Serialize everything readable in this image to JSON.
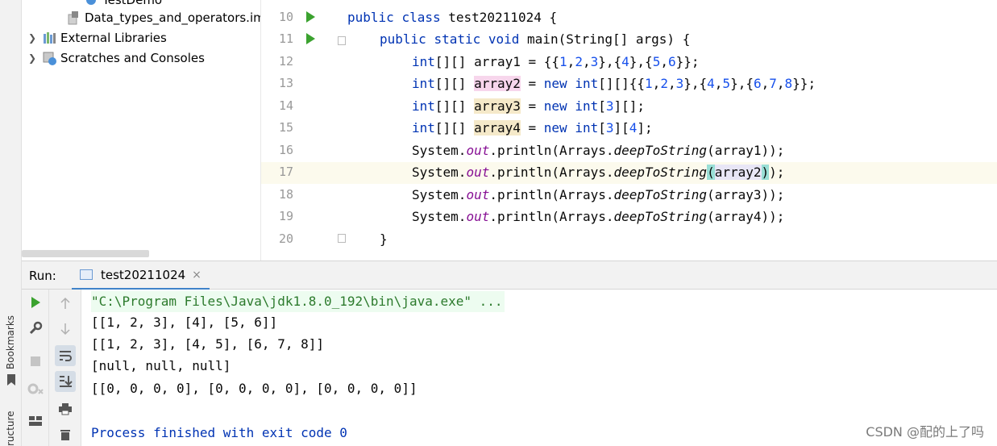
{
  "tool_strip": {
    "bookmarks_label": "Bookmarks",
    "structure_label": "ructure"
  },
  "project_tree": {
    "items": [
      {
        "label": "TestDemo",
        "kind": "module"
      },
      {
        "label": "Data_types_and_operators.iml",
        "kind": "iml-file"
      },
      {
        "label": "External Libraries",
        "kind": "libraries"
      },
      {
        "label": "Scratches and Consoles",
        "kind": "scratches"
      }
    ]
  },
  "editor": {
    "line_numbers": [
      "10",
      "11",
      "12",
      "13",
      "14",
      "15",
      "16",
      "17",
      "18",
      "19",
      "20"
    ],
    "current_line": "17",
    "lines": {
      "l10": {
        "kw1": "public",
        "kw2": "class",
        "rest": " test20211024 {"
      },
      "l11": {
        "kw1": "public",
        "kw2": "static",
        "kw3": "void",
        "rest": " main(String[] args) {"
      },
      "l12": {
        "type": "int",
        "a": "[][] array1 = {{",
        "n1": "1",
        "c1": ",",
        "n2": "2",
        "c2": ",",
        "n3": "3",
        "b1": "},{",
        "n4": "4",
        "b2": "},{",
        "n5": "5",
        "c3": ",",
        "n6": "6",
        "end": "}};"
      },
      "l13": {
        "type": "int",
        "a": "[][] ",
        "var": "array2",
        "b": " = ",
        "kw": "new",
        "sp": " ",
        "type2": "int",
        "c": "[][]{{",
        "n1": "1",
        "c1": ",",
        "n2": "2",
        "c2": ",",
        "n3": "3",
        "d1": "},{",
        "n4": "4",
        "c3": ",",
        "n5": "5",
        "d2": "},{",
        "n6": "6",
        "c4": ",",
        "n7": "7",
        "c5": ",",
        "n8": "8",
        "end": "}};"
      },
      "l14": {
        "type": "int",
        "a": "[][] ",
        "var": "array3",
        "b": " = ",
        "kw": "new",
        "sp": " ",
        "type2": "int",
        "c": "[",
        "n1": "3",
        "end": "][];"
      },
      "l15": {
        "type": "int",
        "a": "[][] ",
        "var": "array4",
        "b": " = ",
        "kw": "new",
        "sp": " ",
        "type2": "int",
        "c": "[",
        "n1": "3",
        "d": "][",
        "n2": "4",
        "end": "];"
      },
      "l16": {
        "cls": "System.",
        "field": "out",
        "m": ".println(Arrays.",
        "stat": "deepToString",
        "arg": "(array1));"
      },
      "l17": {
        "cls": "System.",
        "field": "out",
        "m": ".println(Arrays.",
        "stat": "deepToString",
        "open": "(",
        "arg": "array2",
        "close": ")",
        "end": ");"
      },
      "l18": {
        "cls": "System.",
        "field": "out",
        "m": ".println(Arrays.",
        "stat": "deepToString",
        "arg": "(array3));"
      },
      "l19": {
        "cls": "System.",
        "field": "out",
        "m": ".println(Arrays.",
        "stat": "deepToString",
        "arg": "(array4));"
      },
      "l20": {
        "text": "}"
      }
    }
  },
  "run_window": {
    "label": "Run:",
    "tab_label": "test20211024",
    "close_glyph": "×",
    "console_lines": [
      "\"C:\\Program Files\\Java\\jdk1.8.0_192\\bin\\java.exe\" ...",
      "[[1, 2, 3], [4], [5, 6]]",
      "[[1, 2, 3], [4, 5], [6, 7, 8]]",
      "[null, null, null]",
      "[[0, 0, 0, 0], [0, 0, 0, 0], [0, 0, 0, 0]]",
      "",
      "Process finished with exit code 0"
    ]
  },
  "watermark": "CSDN @配的上了吗",
  "colors": {
    "keyword": "#0033b3",
    "number": "#1750eb",
    "field": "#871094",
    "run_green": "#3ba22f",
    "console_cmd": "#2c7a2c"
  },
  "icons": [
    "run-icon",
    "wrench-icon",
    "stop-icon",
    "debug-settings-icon",
    "layout-icon",
    "arrow-up-icon",
    "arrow-down-icon",
    "soft-wrap-icon",
    "scroll-to-end-icon",
    "print-icon",
    "trash-icon",
    "bookmark-icon"
  ]
}
